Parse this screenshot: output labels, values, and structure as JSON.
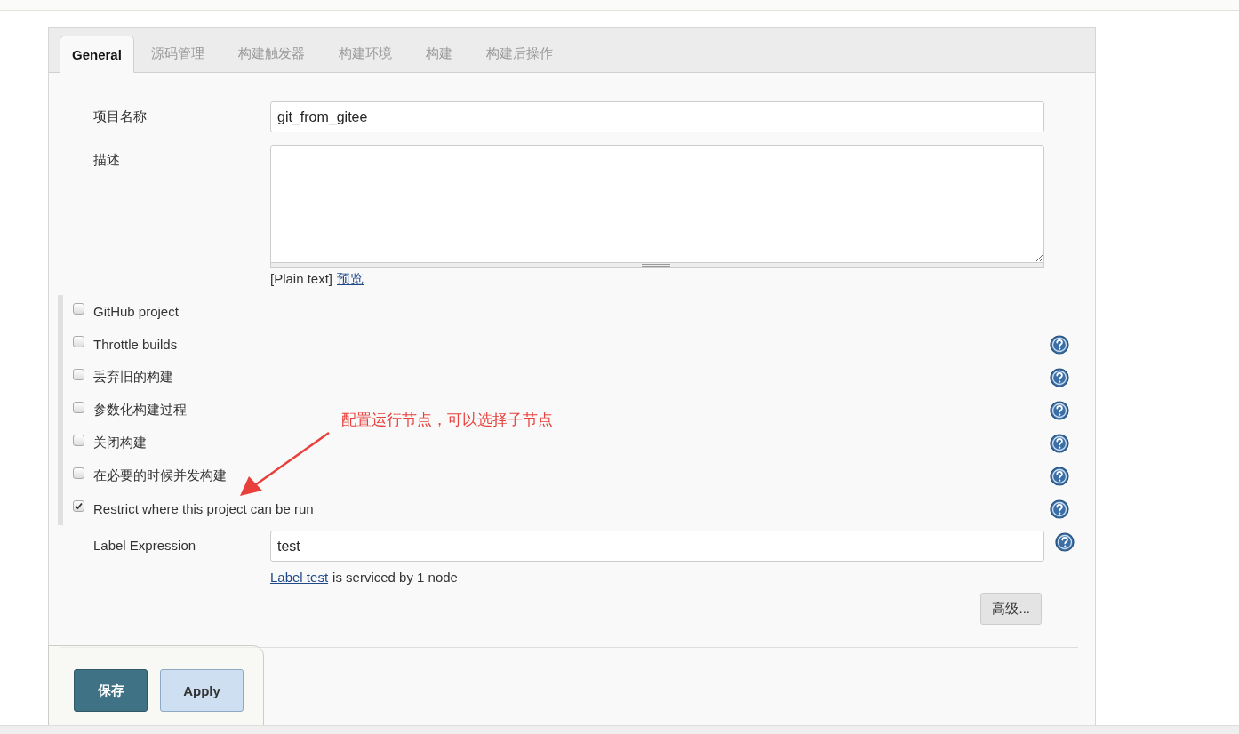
{
  "tabs": [
    {
      "label": "General",
      "selected": true
    },
    {
      "label": "源码管理",
      "selected": false
    },
    {
      "label": "构建触发器",
      "selected": false
    },
    {
      "label": "构建环境",
      "selected": false
    },
    {
      "label": "构建",
      "selected": false
    },
    {
      "label": "构建后操作",
      "selected": false
    }
  ],
  "project_name": {
    "label": "项目名称",
    "value": "git_from_gitee"
  },
  "description": {
    "label": "描述",
    "format_note": "[Plain text]",
    "preview_link": "预览"
  },
  "options": [
    {
      "label": "GitHub project",
      "checked": false,
      "help": false
    },
    {
      "label": "Throttle builds",
      "checked": false,
      "help": true
    },
    {
      "label": "丢弃旧的构建",
      "checked": false,
      "help": true
    },
    {
      "label": "参数化构建过程",
      "checked": false,
      "help": true
    },
    {
      "label": "关闭构建",
      "checked": false,
      "help": true
    },
    {
      "label": "在必要的时候并发构建",
      "checked": false,
      "help": true
    },
    {
      "label": "Restrict where this project can be run",
      "checked": true,
      "help": true
    }
  ],
  "label_expression": {
    "label": "Label Expression",
    "value": "test",
    "status_link": "Label test",
    "status_text": "is serviced by 1 node"
  },
  "advanced_button": "高级...",
  "annotation": "配置运行节点，可以选择子节点",
  "buttons": [
    {
      "label": "保存",
      "kind": "primary"
    },
    {
      "label": "Apply",
      "kind": "secondary"
    }
  ]
}
